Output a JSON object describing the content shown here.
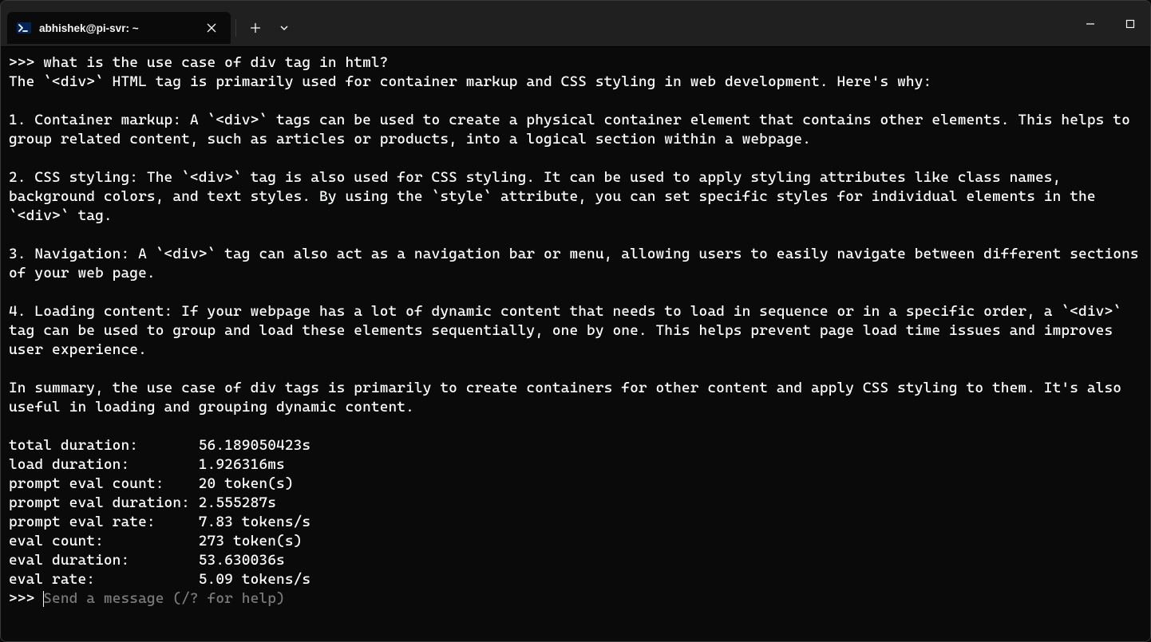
{
  "titlebar": {
    "tab_title": "abhishek@pi-svr: ~"
  },
  "terminal": {
    "prompt_prefix": ">>> ",
    "user_input": "what is the use case of div tag in html?",
    "response_intro": "The `<div>` HTML tag is primarily used for container markup and CSS styling in web development. Here's why:",
    "paragraphs": [
      "1. Container markup: A `<div>` tags can be used to create a physical container element that contains other elements. This helps to group related content, such as articles or products, into a logical section within a webpage.",
      "2. CSS styling: The `<div>` tag is also used for CSS styling. It can be used to apply styling attributes like class names, background colors, and text styles. By using the `style` attribute, you can set specific styles for individual elements in the `<div>` tag.",
      "3. Navigation: A `<div>` tag can also act as a navigation bar or menu, allowing users to easily navigate between different sections of your web page.",
      "4. Loading content: If your webpage has a lot of dynamic content that needs to load in sequence or in a specific order, a `<div>` tag can be used to group and load these elements sequentially, one by one. This helps prevent page load time issues and improves user experience."
    ],
    "summary": "In summary, the use case of div tags is primarily to create containers for other content and apply CSS styling to them. It's also useful in loading and grouping dynamic content.",
    "stats": [
      {
        "label": "total duration:       ",
        "value": "56.189050423s"
      },
      {
        "label": "load duration:        ",
        "value": "1.926316ms"
      },
      {
        "label": "prompt eval count:    ",
        "value": "20 token(s)"
      },
      {
        "label": "prompt eval duration: ",
        "value": "2.555287s"
      },
      {
        "label": "prompt eval rate:     ",
        "value": "7.83 tokens/s"
      },
      {
        "label": "eval count:           ",
        "value": "273 token(s)"
      },
      {
        "label": "eval duration:        ",
        "value": "53.630036s"
      },
      {
        "label": "eval rate:            ",
        "value": "5.09 tokens/s"
      }
    ],
    "input_placeholder": "Send a message (/? for help)"
  }
}
